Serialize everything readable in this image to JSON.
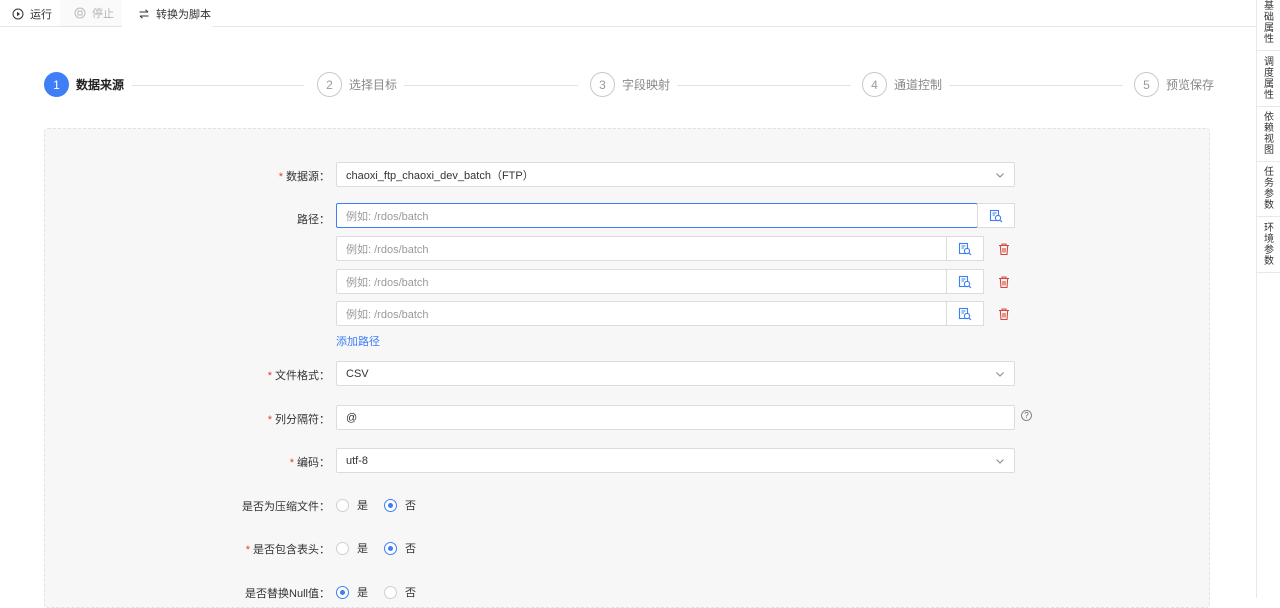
{
  "toolbar": {
    "run_label": "运行",
    "stop_label": "停止",
    "convert_label": "转换为脚本"
  },
  "sidebar": {
    "items": [
      {
        "chars": [
          "基",
          "础",
          "属",
          "性"
        ]
      },
      {
        "chars": [
          "调",
          "度",
          "属",
          "性"
        ]
      },
      {
        "chars": [
          "依",
          "赖",
          "视",
          "图"
        ]
      },
      {
        "chars": [
          "任",
          "务",
          "参",
          "数"
        ]
      },
      {
        "chars": [
          "环",
          "境",
          "参",
          "数"
        ]
      }
    ]
  },
  "steps": [
    {
      "num": "1",
      "label": "数据来源",
      "active": true
    },
    {
      "num": "2",
      "label": "选择目标",
      "active": false
    },
    {
      "num": "3",
      "label": "字段映射",
      "active": false
    },
    {
      "num": "4",
      "label": "通道控制",
      "active": false
    },
    {
      "num": "5",
      "label": "预览保存",
      "active": false
    }
  ],
  "form": {
    "datasource": {
      "label": "数据源",
      "required": true,
      "value": "chaoxi_ftp_chaoxi_dev_batch（FTP）"
    },
    "path": {
      "label": "路径",
      "placeholder": "例如: /rdos/batch",
      "rows": 4,
      "add_label": "添加路径"
    },
    "file_format": {
      "label": "文件格式",
      "required": true,
      "value": "CSV"
    },
    "delimiter": {
      "label": "列分隔符",
      "required": true,
      "value": "@",
      "help_icon": "question-circle-icon"
    },
    "encoding": {
      "label": "编码",
      "required": true,
      "value": "utf-8"
    },
    "compressed": {
      "label": "是否为压缩文件",
      "required": false,
      "options": [
        "是",
        "否"
      ],
      "selected": "否"
    },
    "has_header": {
      "label": "是否包含表头",
      "required": true,
      "options": [
        "是",
        "否"
      ],
      "selected": "否"
    },
    "replace_null": {
      "label": "是否替换Null值",
      "required": false,
      "options": [
        "是",
        "否"
      ],
      "selected": "是"
    }
  },
  "colors": {
    "accent": "#3e7ef6",
    "required": "#e0403a",
    "danger": "#d9443a"
  }
}
